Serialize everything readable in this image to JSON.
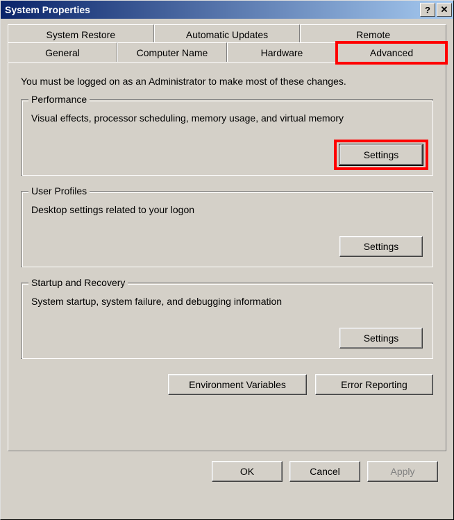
{
  "window": {
    "title": "System Properties"
  },
  "tabs": {
    "back": [
      {
        "label": "System Restore"
      },
      {
        "label": "Automatic Updates"
      },
      {
        "label": "Remote"
      }
    ],
    "front": [
      {
        "label": "General"
      },
      {
        "label": "Computer Name"
      },
      {
        "label": "Hardware"
      },
      {
        "label": "Advanced",
        "active": true,
        "highlight": true
      }
    ]
  },
  "intro": "You must be logged on as an Administrator to make most of these changes.",
  "groups": {
    "performance": {
      "legend": "Performance",
      "desc": "Visual effects, processor scheduling, memory usage, and virtual memory",
      "button": "Settings",
      "highlight": true
    },
    "userprofiles": {
      "legend": "User Profiles",
      "desc": "Desktop settings related to your logon",
      "button": "Settings"
    },
    "startup": {
      "legend": "Startup and Recovery",
      "desc": "System startup, system failure, and debugging information",
      "button": "Settings"
    }
  },
  "lowerButtons": {
    "envvars": "Environment Variables",
    "errorrep": "Error Reporting"
  },
  "dialogButtons": {
    "ok": "OK",
    "cancel": "Cancel",
    "apply": "Apply"
  }
}
